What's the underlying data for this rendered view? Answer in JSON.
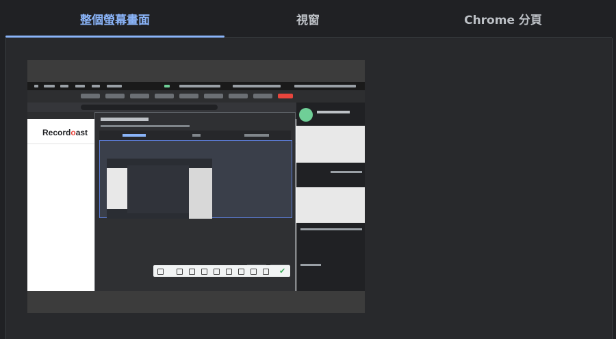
{
  "tabs": [
    {
      "label": "整個螢幕畫面",
      "active": true
    },
    {
      "label": "視窗",
      "active": false
    },
    {
      "label": "Chrome 分頁",
      "active": false
    }
  ],
  "thumbnail": {
    "logo_text_a": "Record",
    "logo_text_o": "o",
    "logo_text_b": "ast"
  },
  "colors": {
    "accent": "#8ab4f8",
    "background": "#202124",
    "panel": "#28292c",
    "tab_inactive": "#bdc1c6"
  }
}
